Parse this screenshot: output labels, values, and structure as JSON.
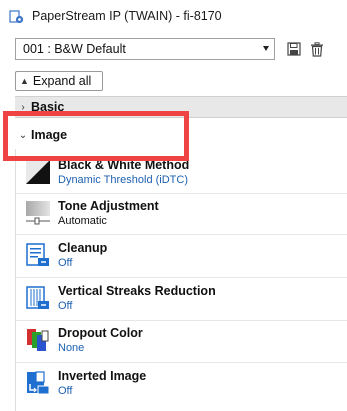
{
  "window": {
    "title": "PaperStream IP (TWAIN) - fi-8170"
  },
  "profile": {
    "selected": "001 : B&W Default"
  },
  "toolbar": {
    "save_icon": "save-icon",
    "delete_icon": "trash-icon"
  },
  "expand_all": {
    "label": "Expand all"
  },
  "sections": {
    "basic": {
      "label": "Basic"
    },
    "image": {
      "label": "Image"
    }
  },
  "items": [
    {
      "name": "Black & White Method",
      "value": "Dynamic Threshold (iDTC)",
      "icon": "black-white-method-icon"
    },
    {
      "name": "Tone Adjustment",
      "value": "Automatic",
      "icon": "tone-adjustment-icon"
    },
    {
      "name": "Cleanup",
      "value": "Off",
      "icon": "cleanup-icon"
    },
    {
      "name": "Vertical Streaks Reduction",
      "value": "Off",
      "icon": "vertical-streaks-icon"
    },
    {
      "name": "Dropout Color",
      "value": "None",
      "icon": "dropout-color-icon"
    },
    {
      "name": "Inverted Image",
      "value": "Off",
      "icon": "inverted-image-icon"
    }
  ],
  "colors": {
    "highlight": "#ee4444",
    "value_text": "#1d60b0",
    "icon_blue": "#1f6fd0"
  }
}
